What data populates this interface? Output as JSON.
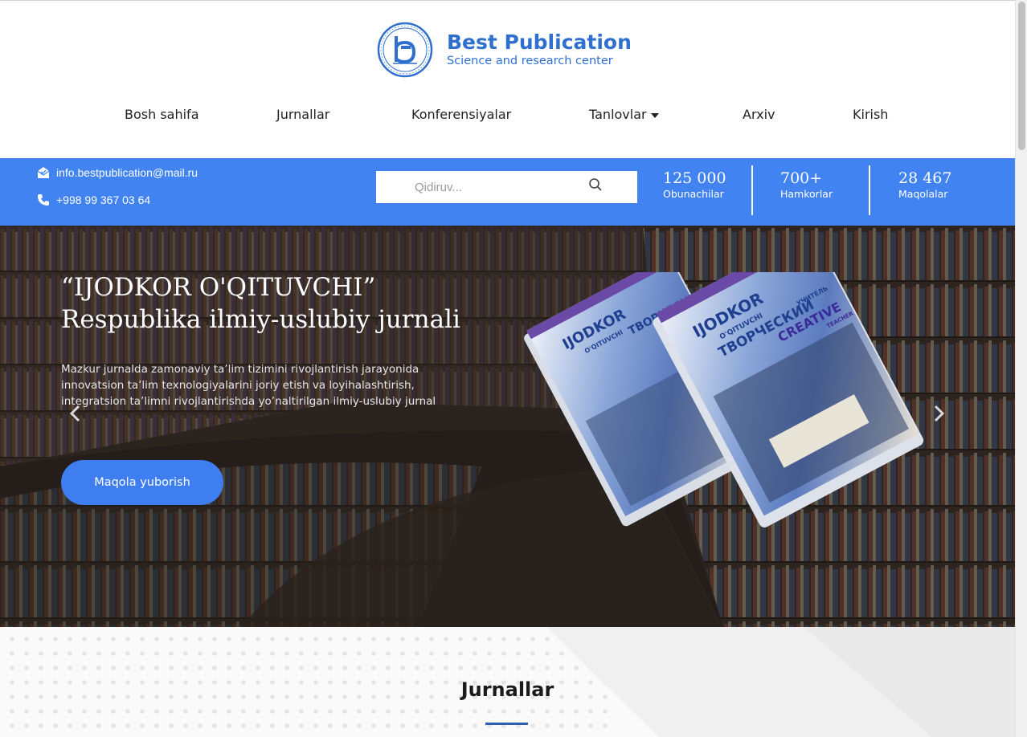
{
  "brand": {
    "title": "Best Publication",
    "subtitle": "Science and research center",
    "accent": "#2f6fcf"
  },
  "nav": {
    "items": [
      {
        "label": "Bosh sahifa"
      },
      {
        "label": "Jurnallar"
      },
      {
        "label": "Konferensiyalar"
      },
      {
        "label": "Tanlovlar",
        "dropdown": true
      },
      {
        "label": "Arxiv"
      },
      {
        "label": "Kirish"
      }
    ]
  },
  "contacts": {
    "email": "info.bestpublication@mail.ru",
    "email_icon": "mail-icon",
    "phone": "+998 99 367 03 64",
    "phone_icon": "phone-icon"
  },
  "search": {
    "placeholder": "Qidiruv...",
    "icon": "search-icon"
  },
  "stats": [
    {
      "value": "125 000",
      "label": "Obunachilar"
    },
    {
      "value": "700+",
      "label": "Hamkorlar"
    },
    {
      "value": "28 467",
      "label": "Maqolalar"
    }
  ],
  "hero": {
    "title_line1": "“IJODKOR O'QITUVCHI”",
    "title_line2": "Respublika ilmiy-uslubiy jurnali",
    "description": "Mazkur jurnalda zamonaviy ta’lim tizimini rivojlantirish jarayonida innovatsion ta’lim texnologiyalarini joriy etish va loyihalashtirish, integratsion ta’limni rivojlantirishda yo’naltirilgan ilmiy-uslubiy jurnal",
    "button": "Maqola yuborish",
    "book_cover": {
      "title": "IJODKOR",
      "subtitle": "O'QITUVCHI",
      "ru_title": "ТВОРЧЕСКИЙ",
      "ru_sub": "УЧИТЕЛЬ",
      "en_title": "CREATIVE",
      "en_sub": "TEACHER"
    }
  },
  "journals": {
    "title": "Jurnallar"
  },
  "colors": {
    "infobar": "#4183f0",
    "button": "#3f7ef1"
  }
}
